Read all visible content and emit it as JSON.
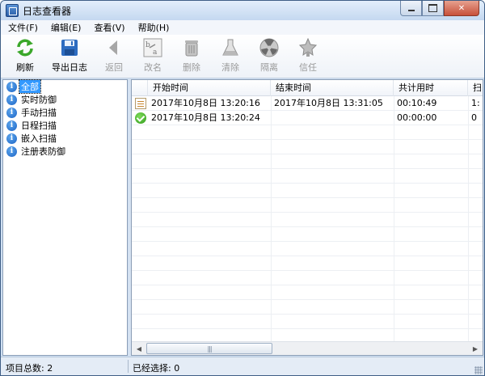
{
  "window": {
    "title": "日志查看器"
  },
  "menubar": {
    "items": [
      "文件(F)",
      "编辑(E)",
      "查看(V)",
      "帮助(H)"
    ]
  },
  "toolbar": {
    "buttons": [
      {
        "label": "刷新",
        "icon": "refresh-icon",
        "enabled": true
      },
      {
        "label": "导出日志",
        "icon": "floppy-disk-icon",
        "enabled": true
      },
      {
        "label": "返回",
        "icon": "back-arrow-icon",
        "enabled": false
      },
      {
        "label": "改名",
        "icon": "rename-icon",
        "enabled": false
      },
      {
        "label": "删除",
        "icon": "trash-icon",
        "enabled": false
      },
      {
        "label": "清除",
        "icon": "flask-icon",
        "enabled": false
      },
      {
        "label": "隔离",
        "icon": "radiation-icon",
        "enabled": false
      },
      {
        "label": "信任",
        "icon": "trust-icon",
        "enabled": false
      }
    ]
  },
  "tree": {
    "items": [
      {
        "label": "全部",
        "selected": true
      },
      {
        "label": "实时防御",
        "selected": false
      },
      {
        "label": "手动扫描",
        "selected": false
      },
      {
        "label": "日程扫描",
        "selected": false
      },
      {
        "label": "嵌入扫描",
        "selected": false
      },
      {
        "label": "注册表防御",
        "selected": false
      }
    ]
  },
  "list": {
    "columns": [
      "开始时间",
      "结束时间",
      "共计用时",
      "扫"
    ],
    "rows": [
      {
        "icon": "log-document-icon",
        "start": "2017年10月8日 13:20:16",
        "end": "2017年10月8日 13:31:05",
        "duration": "00:10:49",
        "extra": "1:"
      },
      {
        "icon": "success-check-icon",
        "start": "2017年10月8日 13:20:24",
        "end": "",
        "duration": "00:00:00",
        "extra": "0"
      }
    ]
  },
  "status": {
    "item_count": "项目总数: 2",
    "selected_count": "已经选择: 0"
  },
  "colors": {
    "selection": "#3399ff",
    "info_icon": "#1a62c4",
    "success_icon": "#2f9a1b"
  }
}
